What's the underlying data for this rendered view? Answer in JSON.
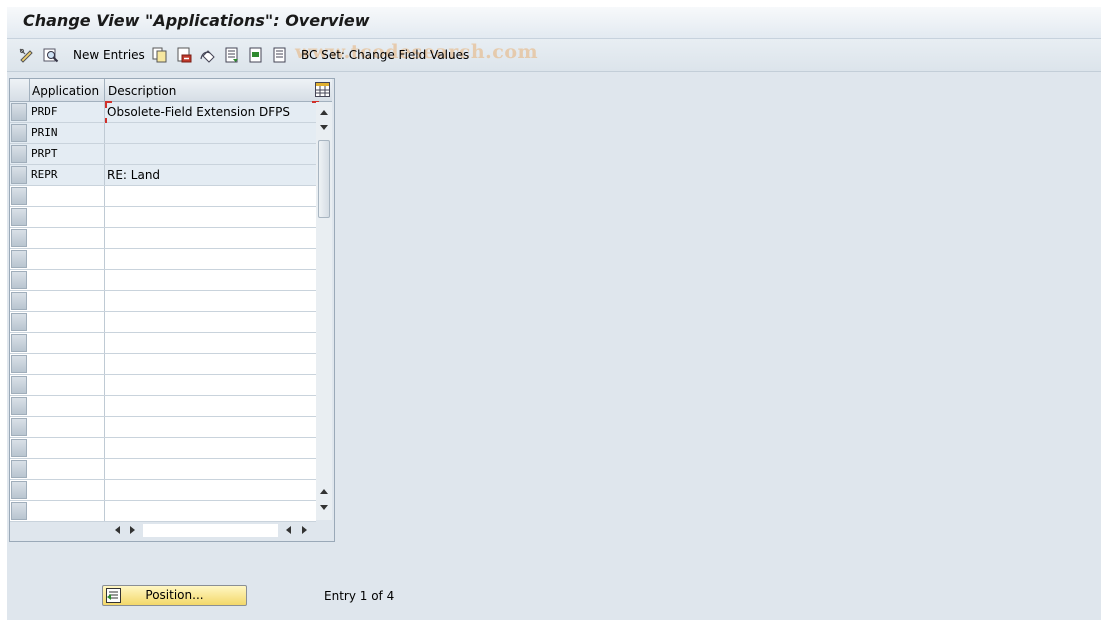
{
  "window": {
    "title": "Change View \"Applications\": Overview"
  },
  "toolbar": {
    "items": [
      {
        "icon": "display-change-icon"
      },
      {
        "icon": "find-icon"
      },
      {
        "label": "New Entries"
      },
      {
        "icon": "copy-icon"
      },
      {
        "icon": "delete-icon"
      },
      {
        "icon": "undo-icon"
      },
      {
        "icon": "select-all-icon"
      },
      {
        "icon": "select-block-icon"
      },
      {
        "icon": "deselect-all-icon"
      },
      {
        "label": "BC Set: Change Field Values"
      }
    ],
    "new_entries_label": "New Entries",
    "bc_set_label": "BC Set: Change Field Values"
  },
  "watermark": "www.tcodesearch.com",
  "table": {
    "columns": [
      "Application",
      "Description"
    ],
    "rows": [
      {
        "application": "PRDF",
        "description": "Obsolete-Field Extension DFPS"
      },
      {
        "application": "PRIN",
        "description": ""
      },
      {
        "application": "PRPT",
        "description": ""
      },
      {
        "application": "REPR",
        "description": "RE: Land"
      }
    ],
    "empty_rows": 16
  },
  "footer": {
    "position_label": "Position...",
    "entry_text": "Entry 1 of 4"
  },
  "colors": {
    "frame_bg": "#dfe6ed",
    "button_yellow": "#f3d86a",
    "focus_red": "#d0302a"
  }
}
